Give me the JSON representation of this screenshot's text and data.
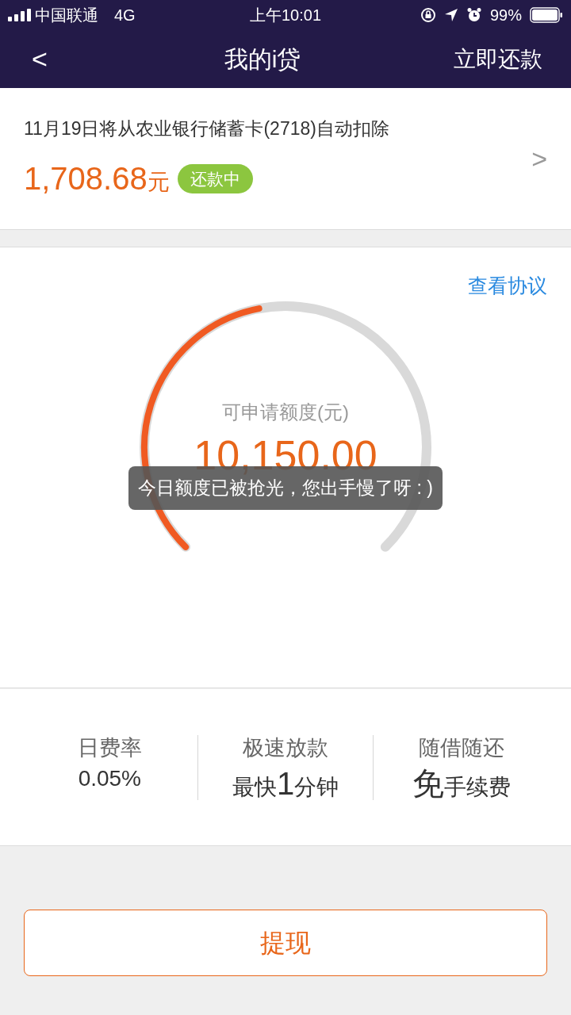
{
  "status_bar": {
    "carrier": "中国联通",
    "network": "4G",
    "time": "上午10:01",
    "battery": "99%"
  },
  "nav": {
    "back": "<",
    "title": "我的i贷",
    "action": "立即还款"
  },
  "repayment": {
    "notice": "11月19日将从农业银行储蓄卡(2718)自动扣除",
    "amount": "1,708.68",
    "unit": "元",
    "badge": "还款中",
    "chevron": ">"
  },
  "credit": {
    "agreement_link": "查看协议",
    "label": "可申请额度(元)",
    "amount": "10,150.00",
    "level": 0.46
  },
  "toast": "今日额度已被抢光，您出手慢了呀 : )",
  "features": [
    {
      "title": "日费率",
      "value": [
        {
          "text": "0.05%",
          "large": false
        }
      ]
    },
    {
      "title": "极速放款",
      "value": [
        {
          "text": "最快",
          "large": false
        },
        {
          "text": "1",
          "large": true
        },
        {
          "text": "分钟",
          "large": false
        }
      ]
    },
    {
      "title": "随借随还",
      "value": [
        {
          "text": "免",
          "large": true
        },
        {
          "text": "手续费",
          "large": false
        }
      ]
    }
  ],
  "withdraw_button": "提现"
}
